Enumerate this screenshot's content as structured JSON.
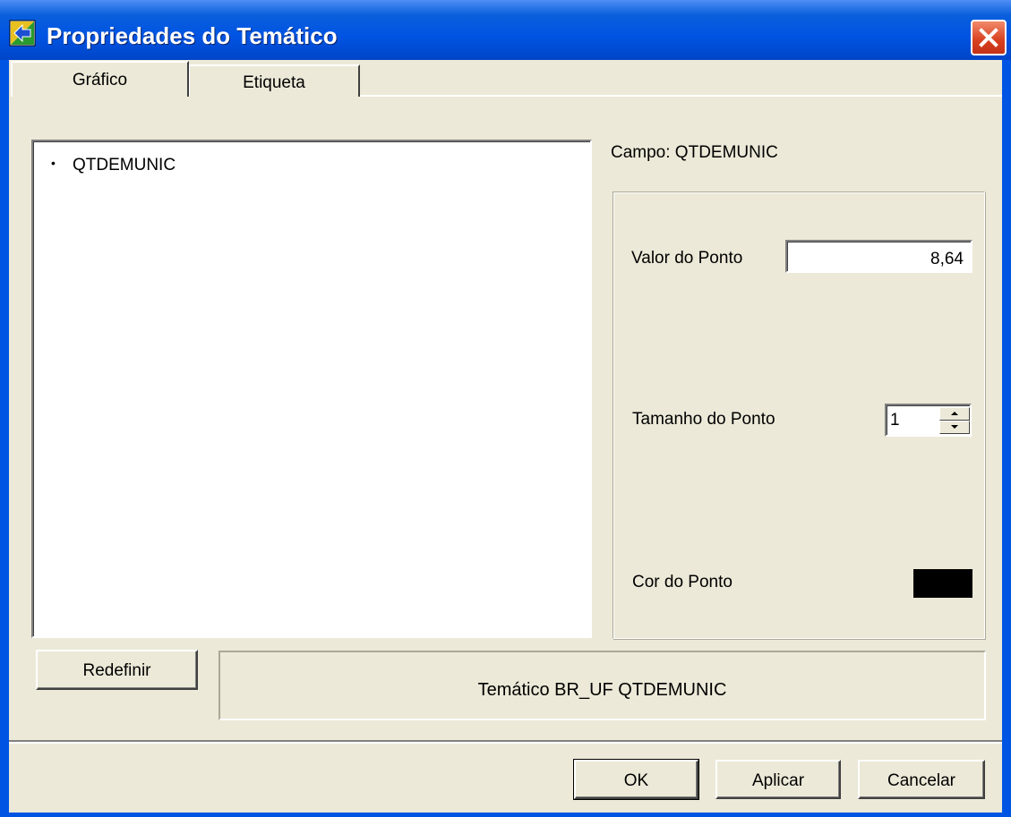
{
  "window": {
    "title": "Propriedades do Temático"
  },
  "tabs": [
    {
      "label": "Gráfico",
      "active": true
    },
    {
      "label": "Etiqueta",
      "active": false
    }
  ],
  "tree": {
    "items": [
      {
        "bullet": "•",
        "label": "QTDEMUNIC"
      }
    ]
  },
  "properties": {
    "campo_label": "Campo: QTDEMUNIC",
    "valor_label": "Valor do Ponto",
    "valor_value": "8,64",
    "tamanho_label": "Tamanho do Ponto",
    "tamanho_value": "1",
    "cor_label": "Cor do Ponto",
    "cor_value": "#000000"
  },
  "footer": {
    "redefinir_label": "Redefinir",
    "status_text": "Temático BR_UF QTDEMUNIC",
    "ok_label": "OK",
    "aplicar_label": "Aplicar",
    "cancelar_label": "Cancelar"
  },
  "icons": {
    "app": "app-icon",
    "close": "close-icon"
  },
  "colors": {
    "titlebar": "#0054e3",
    "dialog_bg": "#ece9d8",
    "close_button": "#d8401e"
  }
}
